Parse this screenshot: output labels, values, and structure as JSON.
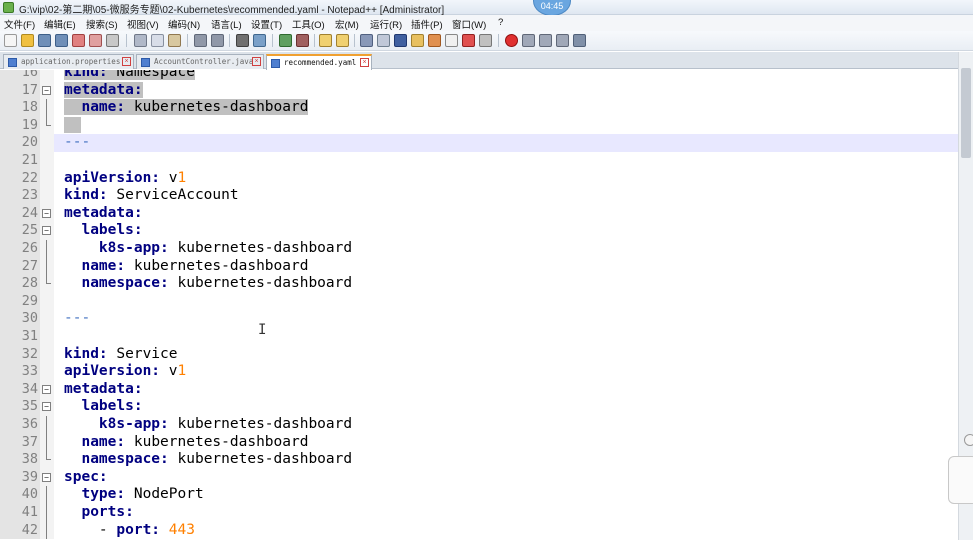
{
  "window": {
    "title": "G:\\vip\\02-第二期\\05-微服务专题\\02-Kubernetes\\recommended.yaml - Notepad++ [Administrator]",
    "clock": "04:45"
  },
  "menu": [
    "文件(F)",
    "编辑(E)",
    "搜索(S)",
    "视图(V)",
    "编码(N)",
    "语言(L)",
    "设置(T)",
    "工具(O)",
    "宏(M)",
    "运行(R)",
    "插件(P)",
    "窗口(W)",
    "?"
  ],
  "tabs": [
    {
      "label": "application.properties"
    },
    {
      "label": "AccountController.java"
    },
    {
      "label": "recommended.yaml"
    }
  ],
  "editor": {
    "caret_line": 20,
    "lines": [
      {
        "n": "16",
        "text": "kind: Namespace"
      },
      {
        "n": "17",
        "text": "metadata:"
      },
      {
        "n": "18",
        "text": "  name: kubernetes-dashboard"
      },
      {
        "n": "19",
        "text": ""
      },
      {
        "n": "20",
        "text": "---"
      },
      {
        "n": "21",
        "text": ""
      },
      {
        "n": "22",
        "text": "apiVersion: v1"
      },
      {
        "n": "23",
        "text": "kind: ServiceAccount"
      },
      {
        "n": "24",
        "text": "metadata:"
      },
      {
        "n": "25",
        "text": "  labels:"
      },
      {
        "n": "26",
        "text": "    k8s-app: kubernetes-dashboard"
      },
      {
        "n": "27",
        "text": "  name: kubernetes-dashboard"
      },
      {
        "n": "28",
        "text": "  namespace: kubernetes-dashboard"
      },
      {
        "n": "29",
        "text": ""
      },
      {
        "n": "30",
        "text": "---"
      },
      {
        "n": "31",
        "text": ""
      },
      {
        "n": "32",
        "text": "kind: Service"
      },
      {
        "n": "33",
        "text": "apiVersion: v1"
      },
      {
        "n": "34",
        "text": "metadata:"
      },
      {
        "n": "35",
        "text": "  labels:"
      },
      {
        "n": "36",
        "text": "    k8s-app: kubernetes-dashboard"
      },
      {
        "n": "37",
        "text": "  name: kubernetes-dashboard"
      },
      {
        "n": "38",
        "text": "  namespace: kubernetes-dashboard"
      },
      {
        "n": "39",
        "text": "spec:"
      },
      {
        "n": "40",
        "text": "  type: NodePort"
      },
      {
        "n": "41",
        "text": "  ports:"
      },
      {
        "n": "42",
        "text": "    - port: 443"
      }
    ]
  }
}
